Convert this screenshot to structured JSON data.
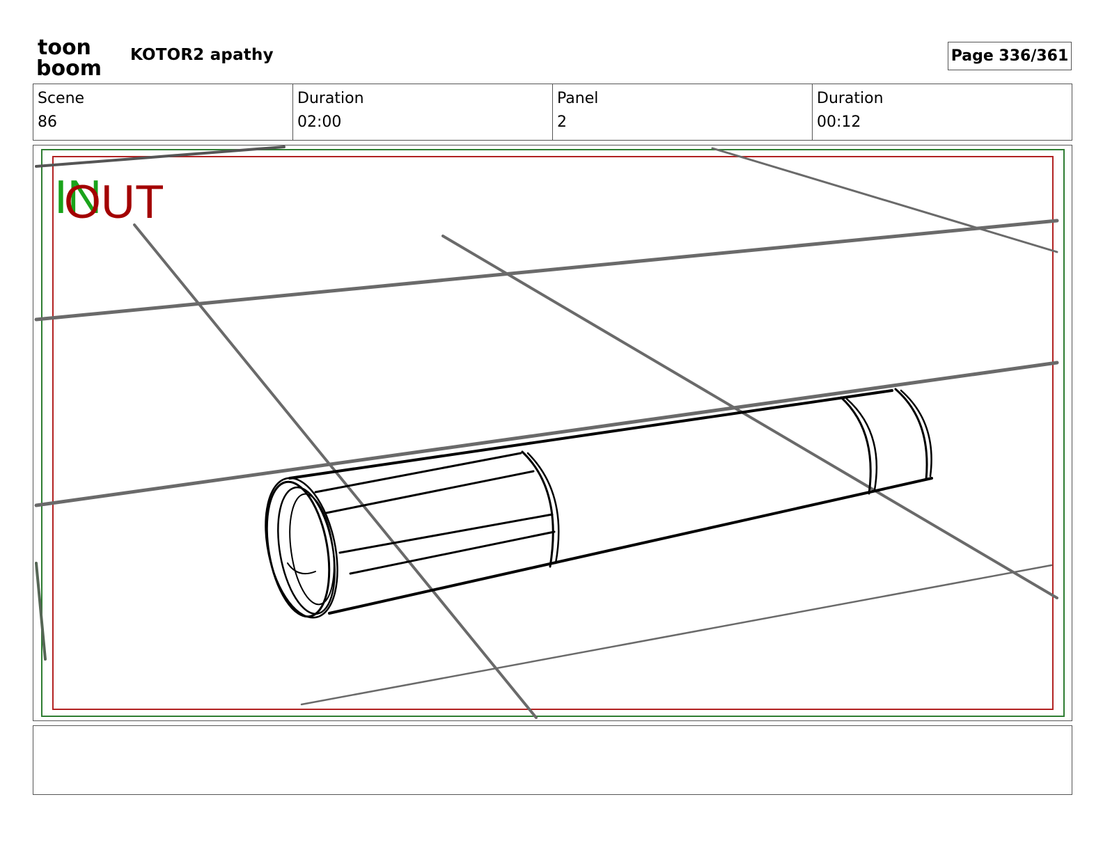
{
  "header": {
    "logo_text_line1": "toon",
    "logo_text_line2": "boom",
    "project_title": "KOTOR2 apathy",
    "page_label": "Page 336/361"
  },
  "info": [
    {
      "label": "Scene",
      "value": "86"
    },
    {
      "label": "Duration",
      "value": "02:00"
    },
    {
      "label": "Panel",
      "value": "2"
    },
    {
      "label": "Duration",
      "value": "00:12"
    }
  ],
  "panel": {
    "in_label": "IN",
    "out_label": "OUT",
    "colors": {
      "in_marker": "#1aa31a",
      "out_marker": "#a30000",
      "safe_frame_green": "#2e7d32",
      "safe_frame_red": "#b22222",
      "guide_lines": "#6a6a6a",
      "sketch_lines": "#000000"
    }
  },
  "caption": {
    "text": ""
  }
}
